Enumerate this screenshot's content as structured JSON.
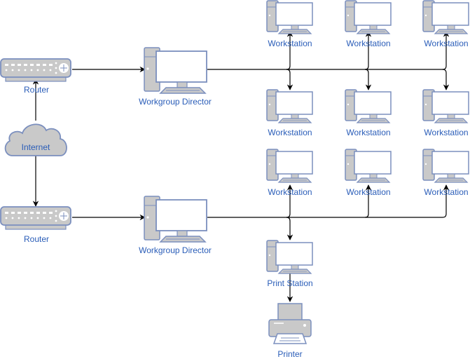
{
  "diagram": {
    "type": "network-topology",
    "colors": {
      "label": "#2a5db8",
      "device_fill": "#c9c9c9",
      "device_stroke": "#7b8fbe",
      "screen_fill": "#ffffff",
      "edge": "#000000"
    },
    "nodes": [
      {
        "id": "router1",
        "kind": "router",
        "label": "Router"
      },
      {
        "id": "router2",
        "kind": "router",
        "label": "Router"
      },
      {
        "id": "internet",
        "kind": "cloud",
        "label": "Internet"
      },
      {
        "id": "director1",
        "kind": "workstation-large",
        "label": "Workgroup Director"
      },
      {
        "id": "director2",
        "kind": "workstation-large",
        "label": "Workgroup Director"
      },
      {
        "id": "ws1",
        "kind": "workstation",
        "label": "Workstation"
      },
      {
        "id": "ws2",
        "kind": "workstation",
        "label": "Workstation"
      },
      {
        "id": "ws3",
        "kind": "workstation",
        "label": "Workstation"
      },
      {
        "id": "ws4",
        "kind": "workstation",
        "label": "Workstation"
      },
      {
        "id": "ws5",
        "kind": "workstation",
        "label": "Workstation"
      },
      {
        "id": "ws6",
        "kind": "workstation",
        "label": "Workstation"
      },
      {
        "id": "ws7",
        "kind": "workstation",
        "label": "Workstation"
      },
      {
        "id": "ws8",
        "kind": "workstation",
        "label": "Workstation"
      },
      {
        "id": "ws9",
        "kind": "workstation",
        "label": "Workstation"
      },
      {
        "id": "printstation",
        "kind": "workstation",
        "label": "Print Station"
      },
      {
        "id": "printer",
        "kind": "printer",
        "label": "Printer"
      }
    ],
    "edges": [
      {
        "from": "internet",
        "to": "router1"
      },
      {
        "from": "internet",
        "to": "router2"
      },
      {
        "from": "router1",
        "to": "director1"
      },
      {
        "from": "router2",
        "to": "director2"
      },
      {
        "from": "director1",
        "to": "ws1"
      },
      {
        "from": "director1",
        "to": "ws2"
      },
      {
        "from": "director1",
        "to": "ws3"
      },
      {
        "from": "director1",
        "to": "ws4"
      },
      {
        "from": "director1",
        "to": "ws5"
      },
      {
        "from": "director1",
        "to": "ws6"
      },
      {
        "from": "director2",
        "to": "ws7"
      },
      {
        "from": "director2",
        "to": "ws8"
      },
      {
        "from": "director2",
        "to": "ws9"
      },
      {
        "from": "director2",
        "to": "printstation"
      },
      {
        "from": "printstation",
        "to": "printer"
      }
    ]
  }
}
